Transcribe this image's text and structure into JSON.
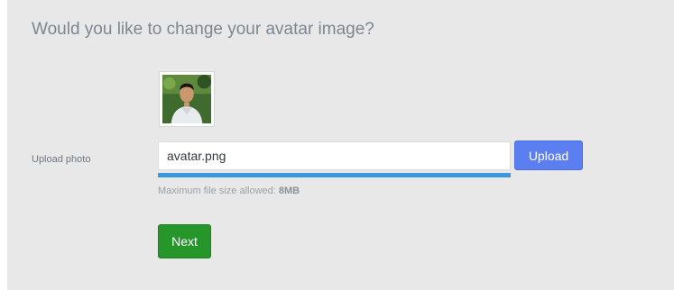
{
  "page": {
    "heading": "Would you like to change your avatar image?"
  },
  "avatar": {
    "icon": "avatar-photo"
  },
  "upload": {
    "label": "Upload photo",
    "file_value": "avatar.png",
    "button_label": "Upload",
    "progress": 1.0,
    "hint_prefix": "Maximum file size allowed: ",
    "hint_size": "8MB"
  },
  "actions": {
    "next_label": "Next"
  },
  "colors": {
    "panel_bg": "#e8e8e8",
    "upload_button": "#5b7ff1",
    "progress": "#3d97dc",
    "next_button": "#27962a"
  }
}
